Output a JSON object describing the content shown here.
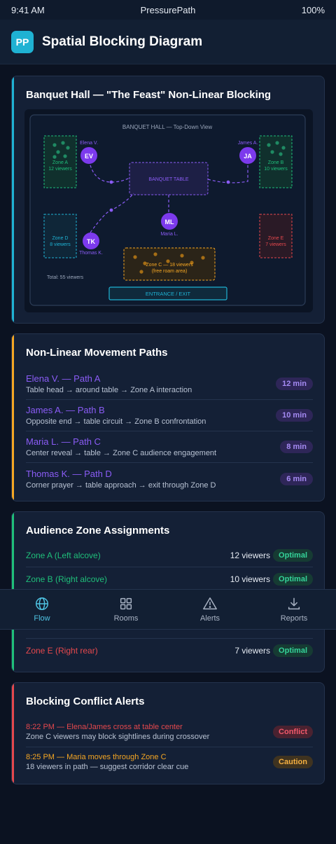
{
  "status": {
    "time": "9:41 AM",
    "app": "PressurePath",
    "battery": "100%"
  },
  "header": {
    "logo": "PP",
    "title": "Spatial Blocking Diagram"
  },
  "colors": {
    "cyan": "#1fb2d3",
    "amber": "#f5a623",
    "green": "#1fbf7a",
    "red": "#e5484d",
    "purple": "#8b5cf6"
  },
  "diagram_card": {
    "title": "Banquet Hall — \"The Feast\" Non-Linear Blocking",
    "diagram": {
      "heading": "BANQUET HALL — Top-Down View",
      "table": "BANQUET TABLE",
      "entrance": "ENTRANCE / EXIT",
      "total": "Total: 55 viewers",
      "zone_a": {
        "name": "Zone A",
        "count": "12 viewers"
      },
      "zone_b": {
        "name": "Zone B",
        "count": "10 viewers"
      },
      "zone_c": {
        "line1": "Zone C — 18 viewers",
        "line2": "(free roam area)"
      },
      "zone_d": {
        "name": "Zone D",
        "count": "8 viewers"
      },
      "zone_e": {
        "name": "Zone E",
        "count": "7 viewers"
      },
      "actors": {
        "ev": {
          "initials": "EV",
          "name": "Elena V."
        },
        "ja": {
          "initials": "JA",
          "name": "James A."
        },
        "ml": {
          "initials": "ML",
          "name": "Maria L."
        },
        "tk": {
          "initials": "TK",
          "name": "Thomas K."
        }
      }
    }
  },
  "paths_card": {
    "title": "Non-Linear Movement Paths",
    "items": [
      {
        "name": "Elena V. — Path A",
        "desc": "Table head → around table → Zone A interaction",
        "duration": "12 min"
      },
      {
        "name": "James A. — Path B",
        "desc": "Opposite end → table circuit → Zone B confrontation",
        "duration": "10 min"
      },
      {
        "name": "Maria L. — Path C",
        "desc": "Center reveal → table → Zone C audience engagement",
        "duration": "8 min"
      },
      {
        "name": "Thomas K. — Path D",
        "desc": "Corner prayer → table approach → exit through Zone D",
        "duration": "6 min"
      }
    ]
  },
  "zones_card": {
    "title": "Audience Zone Assignments",
    "items": [
      {
        "name": "Zone A (Left alcove)",
        "count": "12 viewers",
        "status": "Optimal"
      },
      {
        "name": "Zone B (Right alcove)",
        "count": "10 viewers",
        "status": "Optimal"
      },
      {
        "name": "Zone E (Right rear)",
        "count": "7 viewers",
        "status": "Optimal"
      }
    ]
  },
  "alerts_card": {
    "title": "Blocking Conflict Alerts",
    "items": [
      {
        "title": "8:22 PM — Elena/James cross at table center",
        "desc": "Zone C viewers may block sightlines during crossover",
        "badge": "Conflict"
      },
      {
        "title": "8:25 PM — Maria moves through Zone C",
        "desc": "18 viewers in path — suggest corridor clear cue",
        "badge": "Caution"
      }
    ]
  },
  "tabbar": {
    "tabs": [
      {
        "label": "Flow",
        "icon": "globe-icon"
      },
      {
        "label": "Rooms",
        "icon": "grid-icon"
      },
      {
        "label": "Alerts",
        "icon": "warning-icon"
      },
      {
        "label": "Reports",
        "icon": "download-icon"
      }
    ]
  }
}
